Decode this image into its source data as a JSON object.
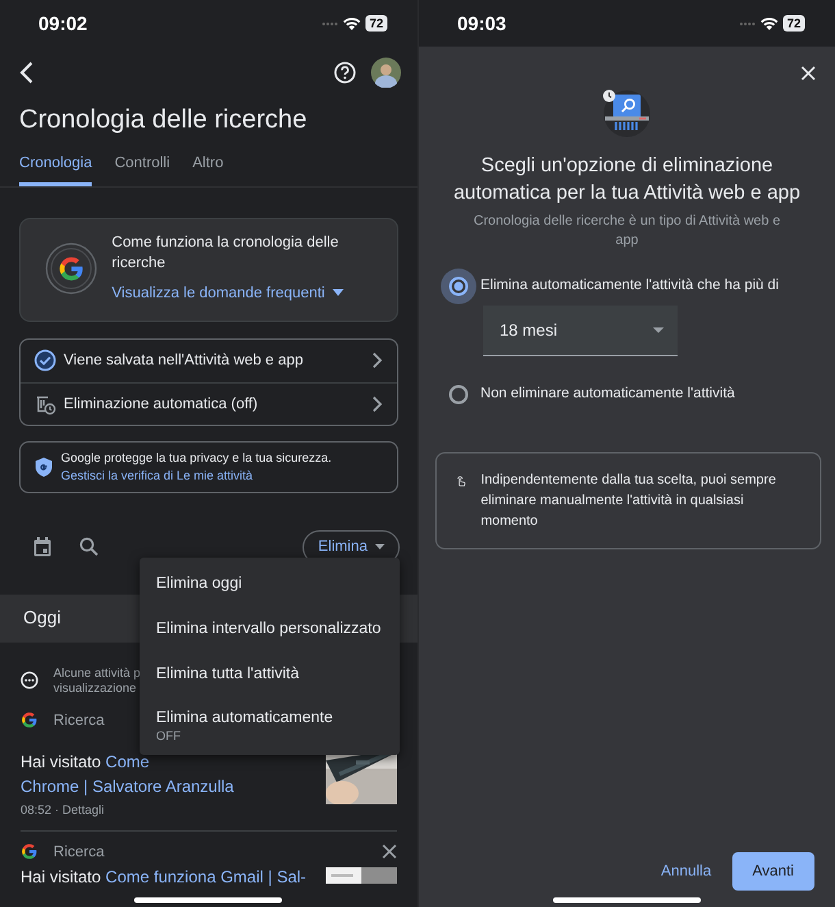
{
  "left_status_bar": {
    "time": "09:02",
    "battery": "72"
  },
  "history": {
    "title": "Cronologia delle ricerche",
    "tabs": [
      {
        "label": "Cronologia",
        "selected": true
      },
      {
        "label": "Controlli",
        "selected": false
      },
      {
        "label": "Altro",
        "selected": false
      }
    ],
    "info_card": {
      "title": "Come funziona la cronologia delle ricerche",
      "link": "Visualizza le domande frequenti"
    },
    "settings": [
      {
        "kind": "saved",
        "label": "Viene salvata nell'Attività web e app"
      },
      {
        "kind": "auto_delete",
        "label": "Eliminazione automatica (off)"
      }
    ],
    "privacy": {
      "text": "Google protegge la tua privacy e la tua sicurezza.",
      "link": "Gestisci la verifica di Le mie attività"
    },
    "delete_button": "Elimina",
    "section": "Oggi",
    "notice": [
      "Alcune attività p",
      "visualizzazione"
    ],
    "items": [
      {
        "source": "Ricerca",
        "prefix": "Hai visitato",
        "link_lines": [
          "Come",
          "Chrome | Salvatore Aranzulla"
        ],
        "meta": "08:52 · Dettagli"
      },
      {
        "source": "Ricerca",
        "prefix": "Hai visitato",
        "link_lines": [
          "Come funziona Gmail | Sal-"
        ],
        "dismissible": true
      }
    ]
  },
  "delete_menu": [
    {
      "label": "Elimina oggi"
    },
    {
      "label": "Elimina intervallo personalizzato"
    },
    {
      "label": "Elimina tutta l'attività"
    },
    {
      "label": "Elimina automaticamente",
      "status": "OFF"
    }
  ],
  "right_status_bar": {
    "time": "09:03",
    "battery": "72"
  },
  "dialog": {
    "title": "Scegli un'opzione di eliminazione automatica per la tua Attività web e app",
    "subtitle": "Cronologia delle ricerche è un tipo di Attività web e app",
    "options": [
      {
        "label": "Elimina automaticamente l'attività che ha più di",
        "selected": true,
        "select_value": "18 mesi"
      },
      {
        "label": "Non eliminare automaticamente l'attività",
        "selected": false
      }
    ],
    "note": "Indipendentemente dalla tua scelta, puoi sempre eliminare manualmente l'attività in qualsiasi momento",
    "buttons": [
      {
        "label": "Annulla",
        "kind": "text"
      },
      {
        "label": "Avanti",
        "kind": "filled"
      }
    ]
  }
}
